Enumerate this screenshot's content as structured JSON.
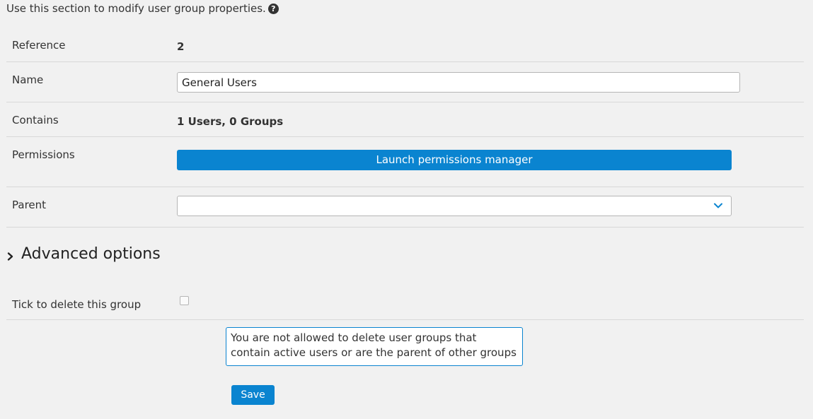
{
  "intro": {
    "text": "Use this section to modify user group properties.",
    "help_icon": "question-circle-icon"
  },
  "fields": {
    "reference": {
      "label": "Reference",
      "value": "2"
    },
    "name": {
      "label": "Name",
      "value": "General Users"
    },
    "contains": {
      "label": "Contains",
      "value": "1 Users, 0 Groups"
    },
    "permissions": {
      "label": "Permissions",
      "button_label": "Launch permissions manager"
    },
    "parent": {
      "label": "Parent",
      "selected": "",
      "icon": "chevron-down-icon"
    }
  },
  "advanced": {
    "title": "Advanced options",
    "icon": "chevron-right-icon"
  },
  "delete": {
    "label": "Tick to delete this group",
    "checked": false,
    "notice": "You are not allowed to delete user groups that contain active users or are the parent of other groups"
  },
  "actions": {
    "save_label": "Save"
  },
  "colors": {
    "background": "#f1f1f1",
    "accent": "#0a84d0",
    "divider": "#d8d8d8"
  }
}
